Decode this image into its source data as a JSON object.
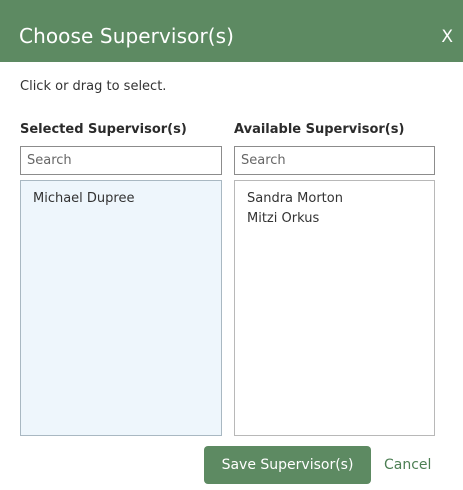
{
  "dialog": {
    "title": "Choose Supervisor(s)",
    "close_label": "X",
    "instruction": "Click or drag to select."
  },
  "selected": {
    "header": "Selected Supervisor(s)",
    "search_placeholder": "Search",
    "items": [
      {
        "label": "Michael Dupree"
      }
    ]
  },
  "available": {
    "header": "Available Supervisor(s)",
    "search_placeholder": "Search",
    "items": [
      {
        "label": "Sandra Morton"
      },
      {
        "label": "Mitzi Orkus"
      }
    ]
  },
  "footer": {
    "save_label": "Save Supervisor(s)",
    "cancel_label": "Cancel"
  },
  "colors": {
    "header_green": "#5d8a62",
    "selected_list_bg": "#eef6fc"
  }
}
